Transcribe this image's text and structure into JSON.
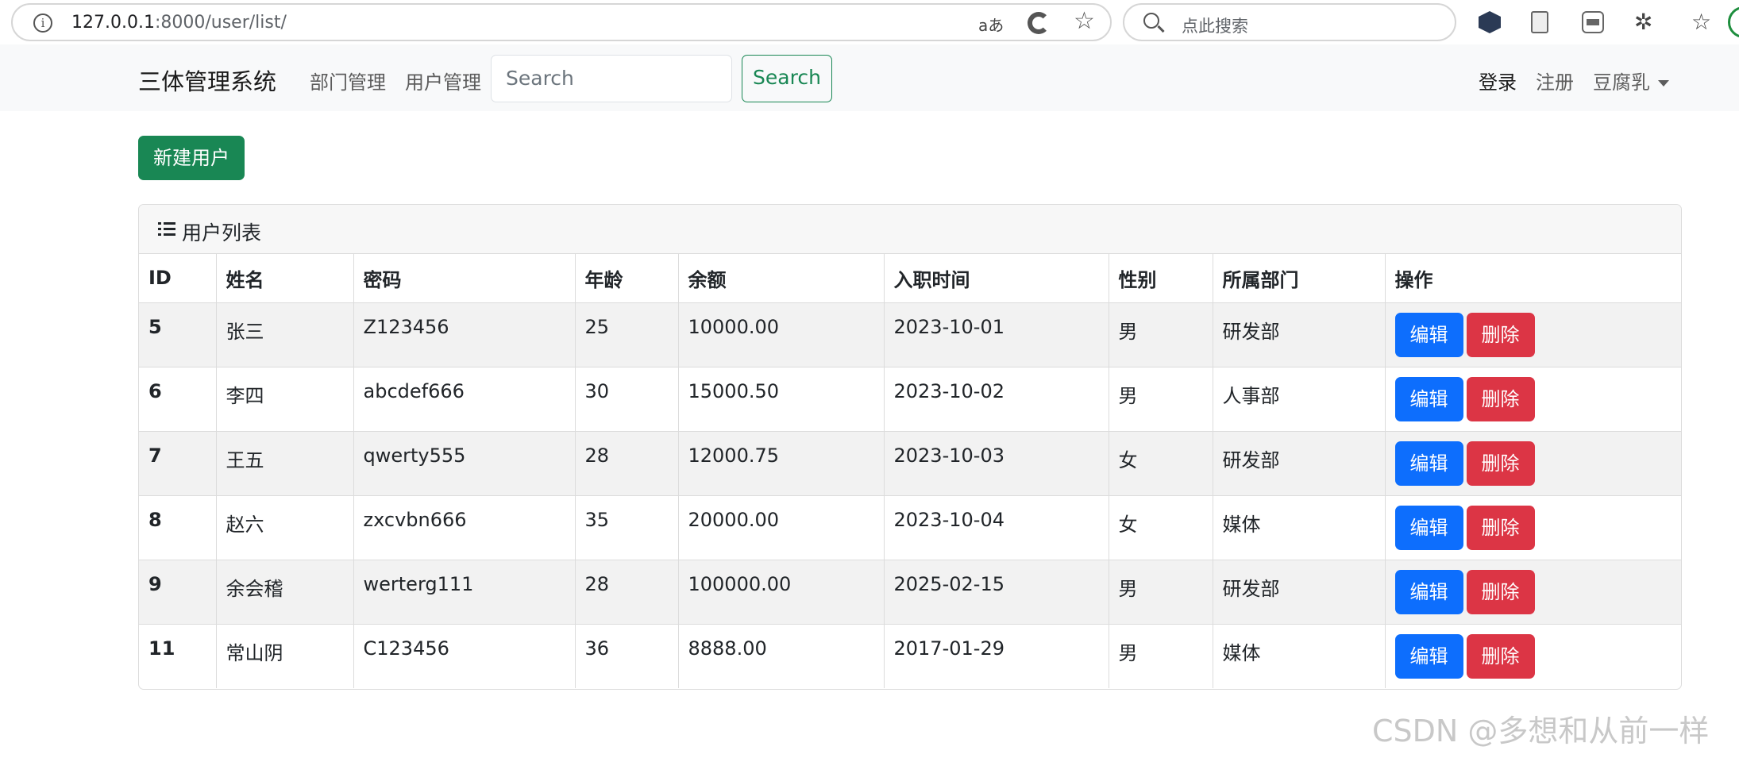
{
  "browser": {
    "url_host": "127.0.0.1",
    "url_rest": ":8000/user/list/",
    "read_aloud_label": "aあ",
    "search_placeholder": "点此搜索"
  },
  "navbar": {
    "brand": "三体管理系统",
    "links": [
      "部门管理",
      "用户管理"
    ],
    "search_placeholder": "Search",
    "search_button": "Search",
    "login": "登录",
    "register": "注册",
    "user_menu": "豆腐乳"
  },
  "actions": {
    "new_user": "新建用户"
  },
  "panel": {
    "title": "用户列表"
  },
  "table": {
    "headers": [
      "ID",
      "姓名",
      "密码",
      "年龄",
      "余额",
      "入职时间",
      "性别",
      "所属部门",
      "操作"
    ],
    "rows": [
      {
        "id": "5",
        "name": "张三",
        "password": "Z123456",
        "age": "25",
        "balance": "10000.00",
        "hire_date": "2023-10-01",
        "gender": "男",
        "dept": "研发部"
      },
      {
        "id": "6",
        "name": "李四",
        "password": "abcdef666",
        "age": "30",
        "balance": "15000.50",
        "hire_date": "2023-10-02",
        "gender": "男",
        "dept": "人事部"
      },
      {
        "id": "7",
        "name": "王五",
        "password": "qwerty555",
        "age": "28",
        "balance": "12000.75",
        "hire_date": "2023-10-03",
        "gender": "女",
        "dept": "研发部"
      },
      {
        "id": "8",
        "name": "赵六",
        "password": "zxcvbn666",
        "age": "35",
        "balance": "20000.00",
        "hire_date": "2023-10-04",
        "gender": "女",
        "dept": "媒体"
      },
      {
        "id": "9",
        "name": "余会稽",
        "password": "werterg111",
        "age": "28",
        "balance": "100000.00",
        "hire_date": "2025-02-15",
        "gender": "男",
        "dept": "研发部"
      },
      {
        "id": "11",
        "name": "常山阴",
        "password": "C123456",
        "age": "36",
        "balance": "8888.00",
        "hire_date": "2017-01-29",
        "gender": "男",
        "dept": "媒体"
      }
    ],
    "edit_label": "编辑",
    "delete_label": "删除"
  },
  "watermark": "CSDN @多想和从前一样",
  "colors": {
    "primary": "#0d6efd",
    "success": "#198754",
    "danger": "#dc3545",
    "navbar_bg": "#f8f9fa"
  }
}
